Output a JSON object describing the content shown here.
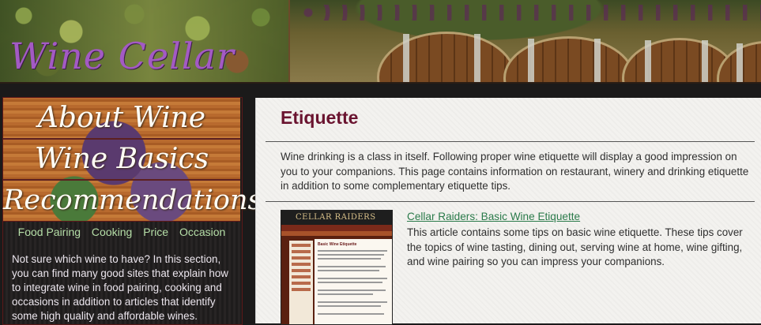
{
  "header": {
    "site_title": "Wine Cellar"
  },
  "sidebar": {
    "nav_items": [
      {
        "label": "About Wine"
      },
      {
        "label": "Wine Basics"
      },
      {
        "label": "Recommendations"
      }
    ],
    "subnav_items": [
      {
        "label": "Food Pairing"
      },
      {
        "label": "Cooking"
      },
      {
        "label": "Price"
      },
      {
        "label": "Occasion"
      }
    ],
    "description": "Not sure which wine to have? In this section, you can find many good sites that explain how to integrate wine in food pairing, cooking and occasions in addition to articles that identify some high quality and affordable wines."
  },
  "main": {
    "page_title": "Etiquette",
    "intro": "Wine drinking is a class in itself. Following proper wine etiquette will display a good impression on you to your companions. This page contains information on restaurant, winery and drinking etiquette in addition to some complementary etiquette tips.",
    "articles": [
      {
        "title": "Cellar Raiders: Basic Wine Etiquette",
        "description": "This article contains some tips on basic wine etiquette. These tips cover the topics of wine tasting, dining out, serving wine at home, wine gifting, and wine pairing so you can impress your companions.",
        "thumbnail_logo": "CELLAR RAIDERS",
        "thumbnail_heading": "Basic Wine Etiquette"
      }
    ]
  },
  "colors": {
    "title_purple": "#a35ac4",
    "heading_maroon": "#6a1430",
    "link_green": "#2a7a4a",
    "subnav_green": "#b6dfa8"
  }
}
